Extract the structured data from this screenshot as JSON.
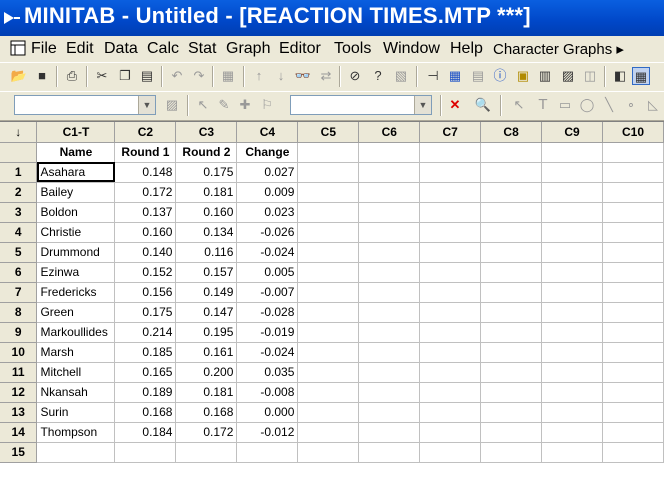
{
  "window": {
    "title": "MINITAB - Untitled - [REACTION TIMES.MTP ***]"
  },
  "menu": [
    "File",
    "Edit",
    "Data",
    "Calc",
    "Stat",
    "Graph",
    "Editor",
    "Tools",
    "Window",
    "Help",
    "Character Graphs ▸"
  ],
  "toolbar1": [
    "open-icon",
    "save-icon",
    "print-icon",
    "cut-icon",
    "copy-icon",
    "paste-icon",
    "undo-icon",
    "redo-icon",
    "edit-last-dialog-icon",
    "previous-icon",
    "next-icon",
    "find-icon",
    "replace-icon",
    "cancel-icon",
    "help-icon",
    "stop-icon",
    "session-window-icon",
    "worksheet-icon",
    "project-manager-icon",
    "info-icon",
    "history-icon",
    "graphs-icon",
    "related-docs-icon",
    "reportpad-icon",
    "toggle-icon-a",
    "toggle-icon-b"
  ],
  "toolbar2": {
    "combo1": "",
    "combo2": ""
  },
  "worksheet": {
    "corner": "↓",
    "columns": [
      "C1-T",
      "C2",
      "C3",
      "C4",
      "C5",
      "C6",
      "C7",
      "C8",
      "C9",
      "C10"
    ],
    "names": [
      "Name",
      "Round 1",
      "Round 2",
      "Change",
      "",
      "",
      "",
      "",
      "",
      ""
    ],
    "rows": [
      {
        "n": "1",
        "name": "Asahara",
        "r1": "0.148",
        "r2": "0.175",
        "ch": "0.027"
      },
      {
        "n": "2",
        "name": "Bailey",
        "r1": "0.172",
        "r2": "0.181",
        "ch": "0.009"
      },
      {
        "n": "3",
        "name": "Boldon",
        "r1": "0.137",
        "r2": "0.160",
        "ch": "0.023"
      },
      {
        "n": "4",
        "name": "Christie",
        "r1": "0.160",
        "r2": "0.134",
        "ch": "-0.026"
      },
      {
        "n": "5",
        "name": "Drummond",
        "r1": "0.140",
        "r2": "0.116",
        "ch": "-0.024"
      },
      {
        "n": "6",
        "name": "Ezinwa",
        "r1": "0.152",
        "r2": "0.157",
        "ch": "0.005"
      },
      {
        "n": "7",
        "name": "Fredericks",
        "r1": "0.156",
        "r2": "0.149",
        "ch": "-0.007"
      },
      {
        "n": "8",
        "name": "Green",
        "r1": "0.175",
        "r2": "0.147",
        "ch": "-0.028"
      },
      {
        "n": "9",
        "name": "Markoullides",
        "r1": "0.214",
        "r2": "0.195",
        "ch": "-0.019"
      },
      {
        "n": "10",
        "name": "Marsh",
        "r1": "0.185",
        "r2": "0.161",
        "ch": "-0.024"
      },
      {
        "n": "11",
        "name": "Mitchell",
        "r1": "0.165",
        "r2": "0.200",
        "ch": "0.035"
      },
      {
        "n": "12",
        "name": "Nkansah",
        "r1": "0.189",
        "r2": "0.181",
        "ch": "-0.008"
      },
      {
        "n": "13",
        "name": "Surin",
        "r1": "0.168",
        "r2": "0.168",
        "ch": "0.000"
      },
      {
        "n": "14",
        "name": "Thompson",
        "r1": "0.184",
        "r2": "0.172",
        "ch": "-0.012"
      },
      {
        "n": "15",
        "name": "",
        "r1": "",
        "r2": "",
        "ch": ""
      }
    ]
  }
}
